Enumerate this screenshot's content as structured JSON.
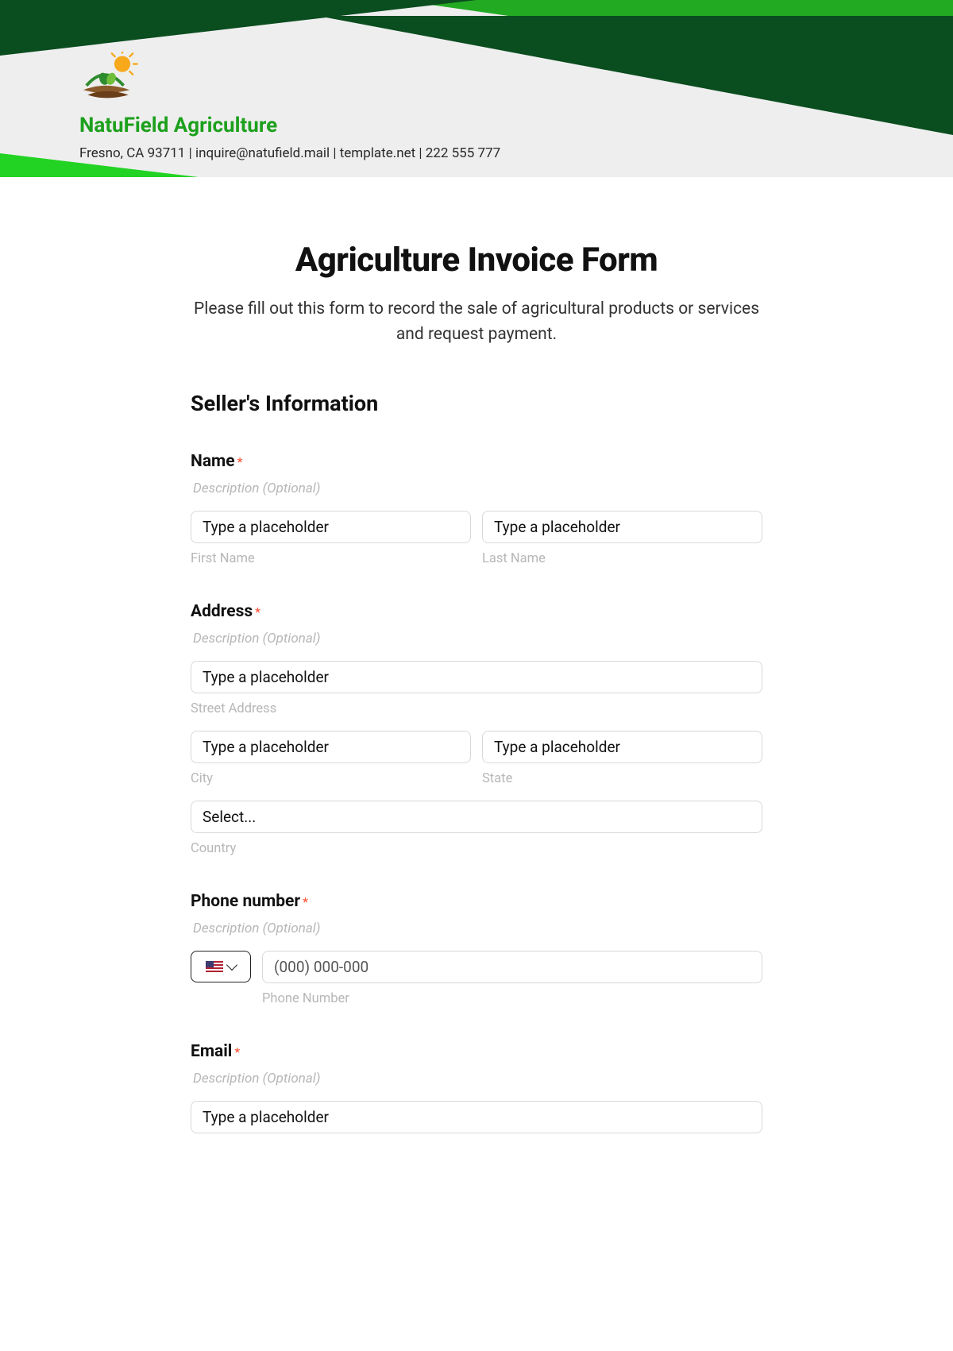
{
  "company": {
    "name": "NatuField Agriculture",
    "info": "Fresno, CA 93711  | inquire@natufield.mail  | template.net  | 222 555 777"
  },
  "form": {
    "title": "Agriculture Invoice Form",
    "subtitle": "Please fill out this form to record the sale of agricultural products or services and request payment.",
    "sections": {
      "seller": "Seller's Information"
    },
    "fields": {
      "name": {
        "label": "Name",
        "desc": "Description (Optional)",
        "first_placeholder": "Type a placeholder",
        "first_sub": "First Name",
        "last_placeholder": "Type a placeholder",
        "last_sub": "Last Name"
      },
      "address": {
        "label": "Address",
        "desc": "Description (Optional)",
        "street_placeholder": "Type a placeholder",
        "street_sub": "Street Address",
        "city_placeholder": "Type a placeholder",
        "city_sub": "City",
        "state_placeholder": "Type a placeholder",
        "state_sub": "State",
        "country_placeholder": "Select...",
        "country_sub": "Country"
      },
      "phone": {
        "label": "Phone number",
        "desc": "Description (Optional)",
        "placeholder": "(000) 000-000",
        "sub": "Phone Number"
      },
      "email": {
        "label": "Email",
        "desc": "Description (Optional)",
        "placeholder": "Type a placeholder"
      }
    }
  }
}
